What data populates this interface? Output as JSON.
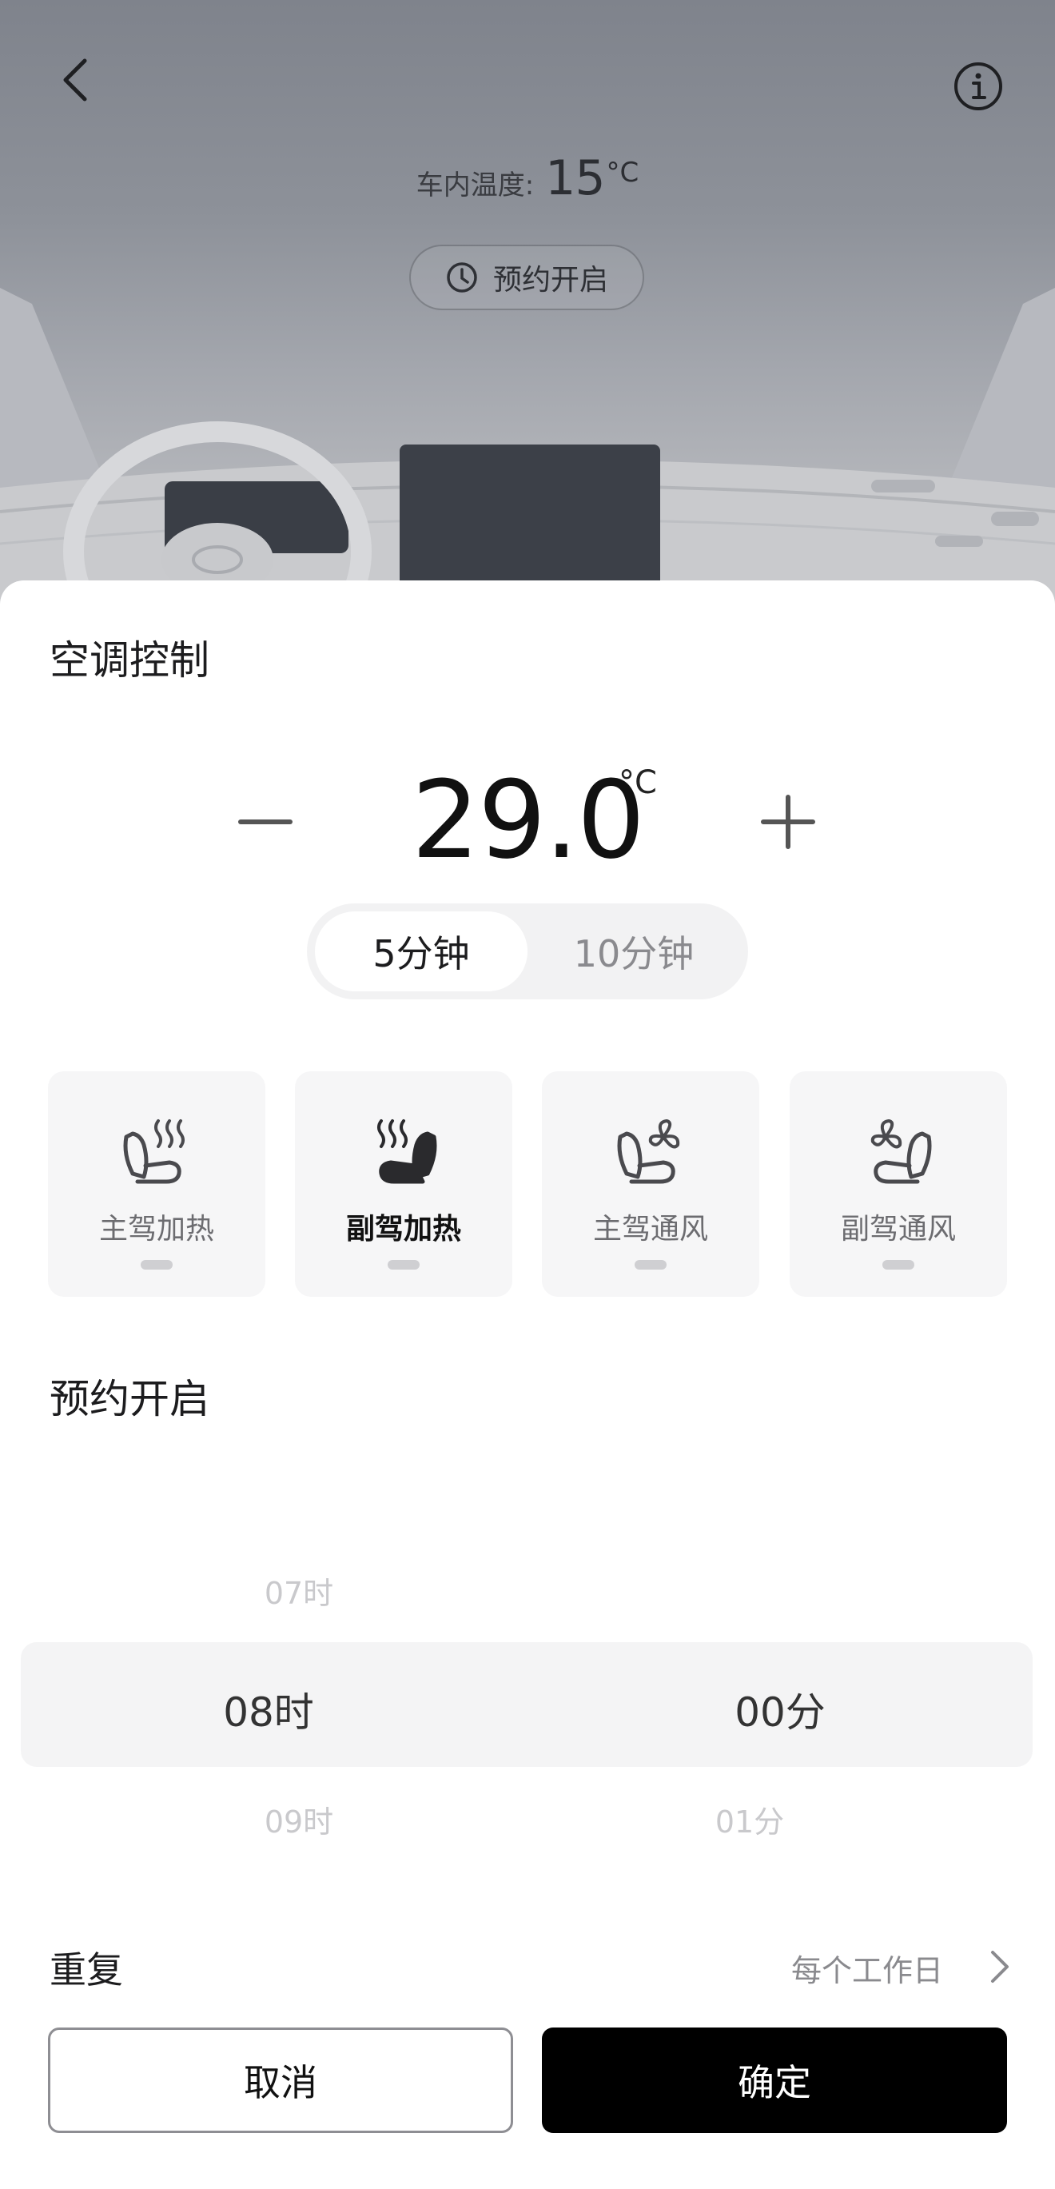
{
  "header": {
    "cabin_temp_label": "车内温度:",
    "cabin_temp_value": "15",
    "cabin_temp_unit": "°C",
    "schedule_button_label": "预约开启",
    "icons": {
      "back": "chevron-left-icon",
      "info": "info-icon",
      "schedule": "clock-icon"
    }
  },
  "climate": {
    "title": "空调控制",
    "temperature": "29.0",
    "unit": "°C",
    "durations": [
      {
        "label": "5分钟",
        "selected": true
      },
      {
        "label": "10分钟",
        "selected": false
      }
    ],
    "seats": [
      {
        "label": "主驾加热",
        "icon": "driver-seat-heat-icon",
        "active": false
      },
      {
        "label": "副驾加热",
        "icon": "passenger-seat-heat-icon",
        "active": true
      },
      {
        "label": "主驾通风",
        "icon": "driver-seat-vent-icon",
        "active": false
      },
      {
        "label": "副驾通风",
        "icon": "passenger-seat-vent-icon",
        "active": false
      }
    ]
  },
  "schedule": {
    "title": "预约开启",
    "hour_prev": "07时",
    "hour_selected": "08时",
    "hour_next": "09时",
    "minute_selected": "00分",
    "minute_next": "01分"
  },
  "repeat": {
    "label": "重复",
    "value": "每个工作日"
  },
  "actions": {
    "cancel": "取消",
    "confirm": "确定"
  },
  "colors": {
    "confirm_bg": "#000000",
    "accent_text": "#111111",
    "muted_text": "#8a8a8e"
  }
}
